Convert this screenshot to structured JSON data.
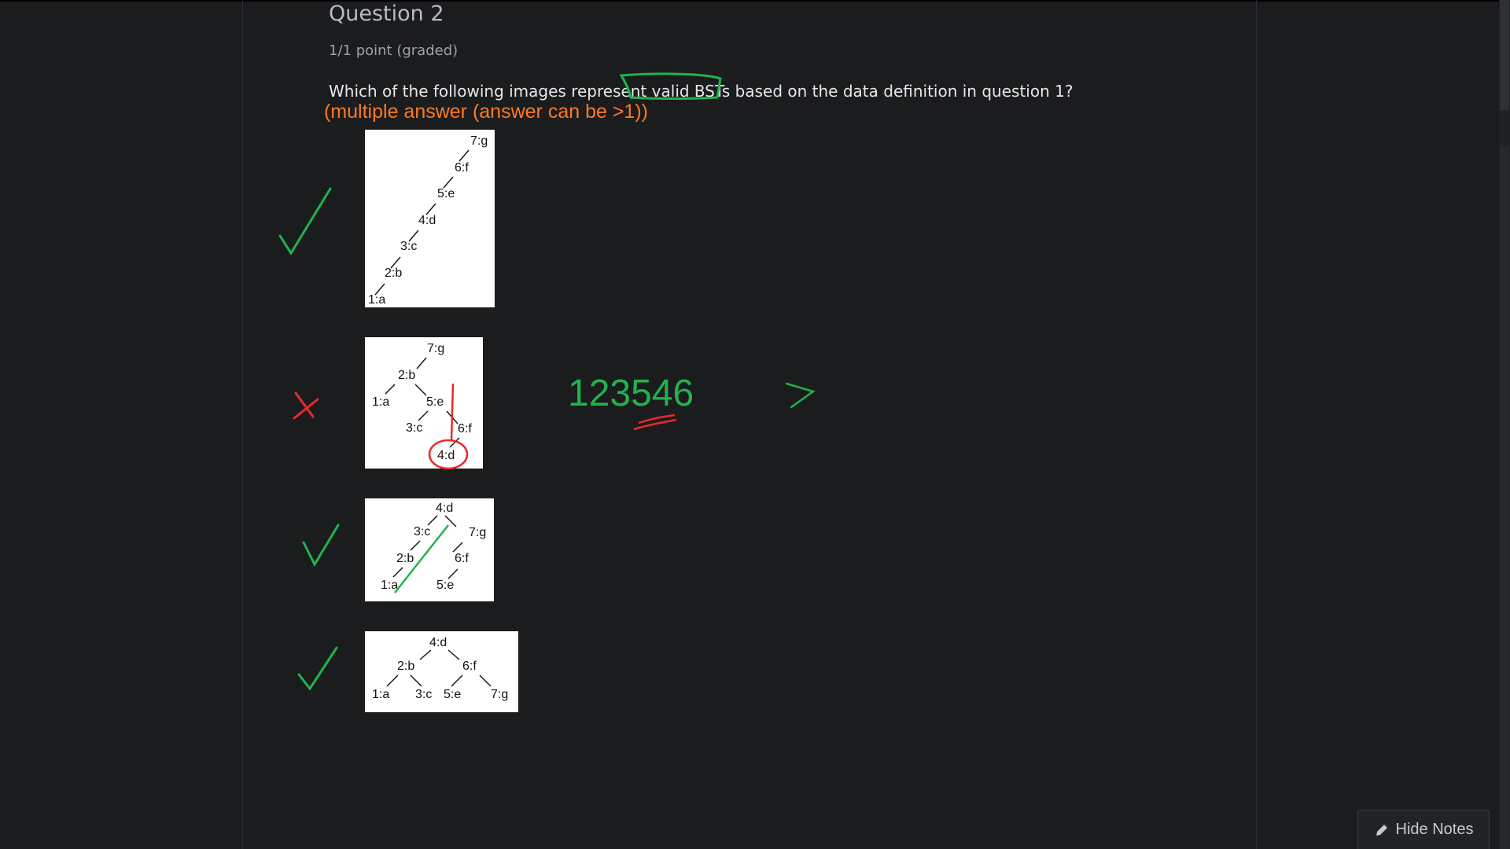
{
  "question": {
    "title": "Question 2",
    "points": "1/1 point (graded)",
    "prompt": "Which of the following images represent valid BSTs based on the data definition in question 1?",
    "handwritten_note": "(multiple answer (answer can be >1))"
  },
  "options": [
    {
      "id": 1,
      "mark": "check",
      "nodes": [
        "7:g",
        "6:f",
        "5:e",
        "4:d",
        "3:c",
        "2:b",
        "1:a"
      ]
    },
    {
      "id": 2,
      "mark": "cross",
      "nodes": [
        "7:g",
        "2:b",
        "1:a",
        "5:e",
        "3:c",
        "6:f",
        "4:d"
      ]
    },
    {
      "id": 3,
      "mark": "check",
      "nodes": [
        "4:d",
        "3:c",
        "7:g",
        "2:b",
        "6:f",
        "1:a",
        "5:e"
      ]
    },
    {
      "id": 4,
      "mark": "check",
      "nodes": [
        "4:d",
        "2:b",
        "6:f",
        "1:a",
        "3:c",
        "5:e",
        "7:g"
      ]
    }
  ],
  "annotation": {
    "sequence_text": "123546",
    "arrow": ">"
  },
  "notes_button": {
    "label": "Hide Notes",
    "icon": "pencil-icon"
  },
  "colors": {
    "check": "#22b24c",
    "cross": "#e8292b",
    "note": "#ff7a1f",
    "highlight": "#22b24c"
  }
}
